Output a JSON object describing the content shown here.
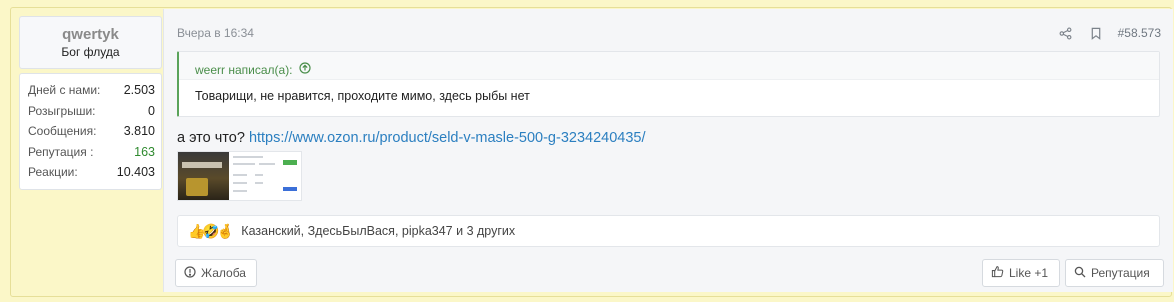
{
  "user": {
    "name": "qwertyk",
    "title": "Бог флуда",
    "stats": [
      {
        "label": "Дней с нами:",
        "value": "2.503"
      },
      {
        "label": "Розыгрыши:",
        "value": "0"
      },
      {
        "label": "Сообщения:",
        "value": "3.810"
      },
      {
        "label": "Репутация :",
        "value": "163"
      },
      {
        "label": "Реакции:",
        "value": "10.403"
      }
    ]
  },
  "post": {
    "date": "Вчера в 16:34",
    "number": "#58.573",
    "quote": {
      "author": "weerr написал(а):",
      "text": "Товарищи, не нравится, проходите мимо, здесь рыбы нет"
    },
    "message_prefix": "а это что? ",
    "link": "https://www.ozon.ru/product/seld-v-masle-500-g-3234240435/",
    "reactions": {
      "icons": "👍🤣🤞",
      "text": "Казанский, ЗдесьБылВася, pipka347 и 3 других"
    }
  },
  "actions": {
    "report": "Жалоба",
    "like": "Like +1",
    "reputation": "Репутация"
  },
  "colors": {
    "background": "#fbf7c8",
    "link": "#2b7fc0",
    "quote_accent": "#5aa35a",
    "reputation_value": "#2f8a2f"
  }
}
